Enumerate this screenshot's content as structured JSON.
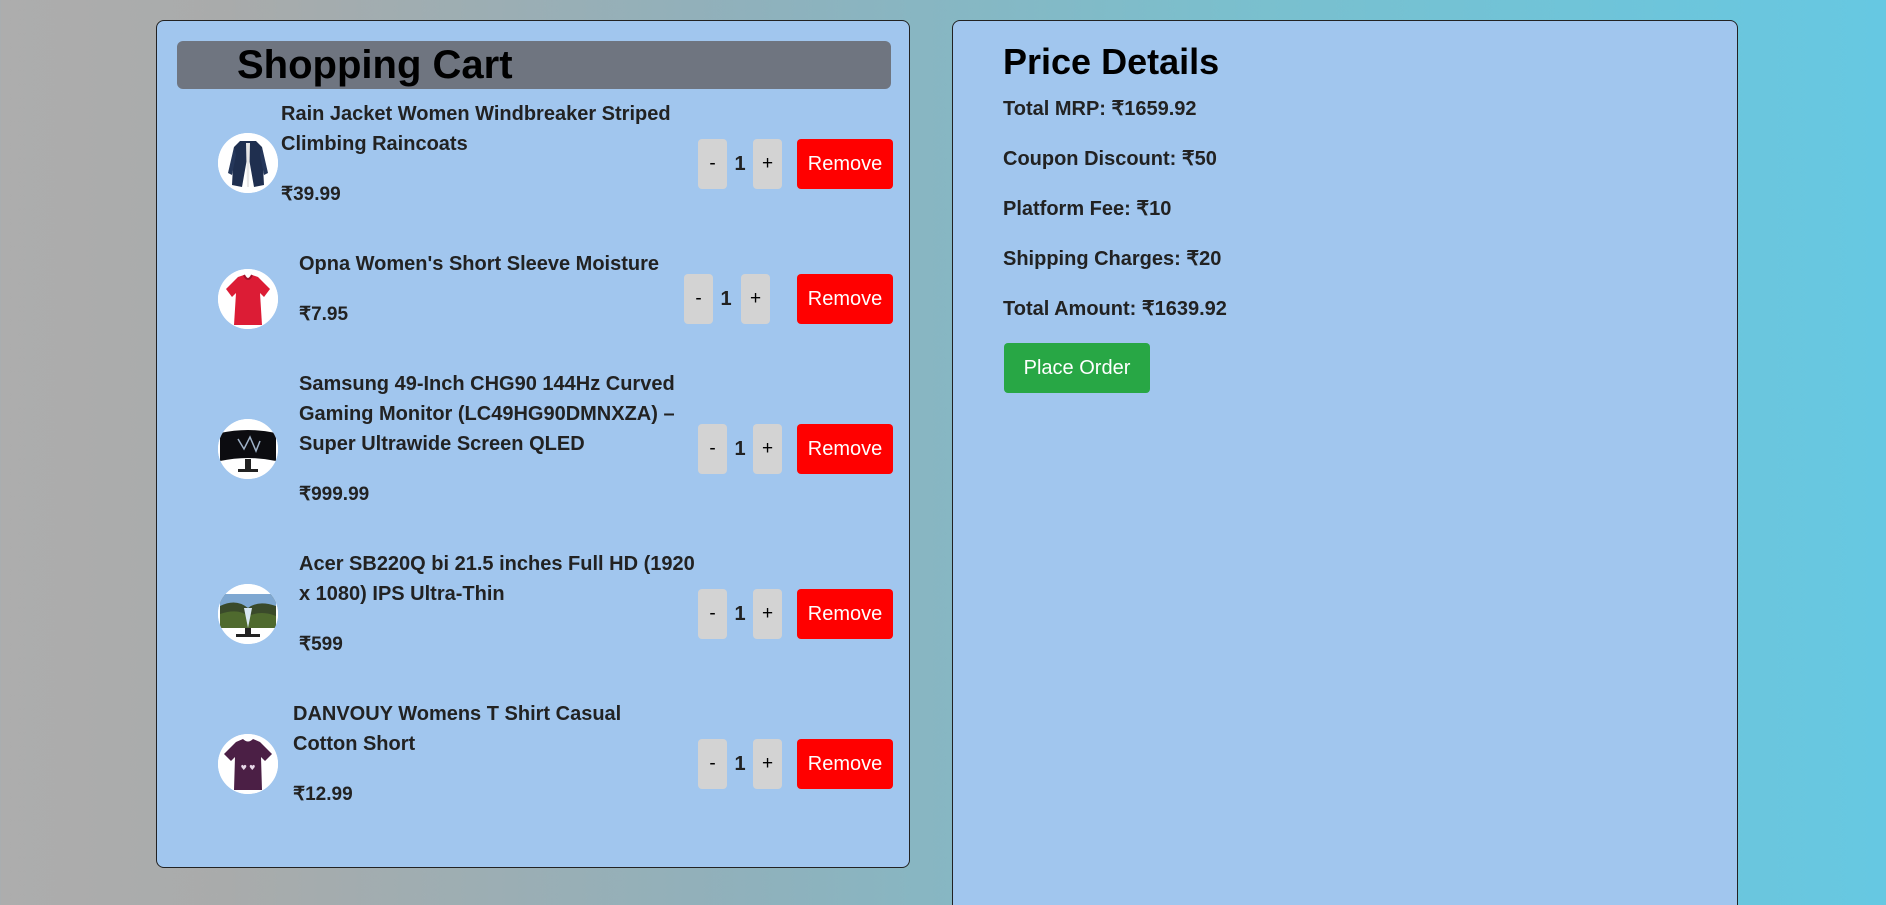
{
  "cart": {
    "title": "Shopping Cart",
    "items": [
      {
        "name": "Rain Jacket Women Windbreaker Striped Climbing Raincoats",
        "price": "₹39.99",
        "quantity": "1",
        "thumb_icon": "jacket-thumbnail"
      },
      {
        "name": "Opna Women's Short Sleeve Moisture",
        "price": "₹7.95",
        "quantity": "1",
        "thumb_icon": "red-shirt-thumbnail"
      },
      {
        "name": "Samsung 49-Inch CHG90 144Hz Curved Gaming Monitor (LC49HG90DMNXZA) – Super Ultrawide Screen QLED",
        "price": "₹999.99",
        "quantity": "1",
        "thumb_icon": "curved-monitor-thumbnail"
      },
      {
        "name": "Acer SB220Q bi 21.5 inches Full HD (1920 x 1080) IPS Ultra-Thin",
        "price": "₹599",
        "quantity": "1",
        "thumb_icon": "monitor-thumbnail"
      },
      {
        "name": "DANVOUY Womens T Shirt Casual Cotton Short",
        "price": "₹12.99",
        "quantity": "1",
        "thumb_icon": "purple-tshirt-thumbnail"
      }
    ],
    "minus_label": "-",
    "plus_label": "+",
    "remove_label": "Remove"
  },
  "price_details": {
    "title": "Price Details",
    "total_mrp": "Total MRP: ₹1659.92",
    "coupon_discount": "Coupon Discount: ₹50",
    "platform_fee": "Platform Fee: ₹10",
    "shipping_charges": "Shipping Charges: ₹20",
    "total_amount": "Total Amount: ₹1639.92",
    "place_order_label": "Place Order"
  },
  "colors": {
    "panel_bg": "#a1c6ee",
    "header_bg": "#6f7580",
    "remove_button": "#ff0000",
    "place_order_button": "#28a745",
    "qty_button": "#d3d3d3"
  }
}
